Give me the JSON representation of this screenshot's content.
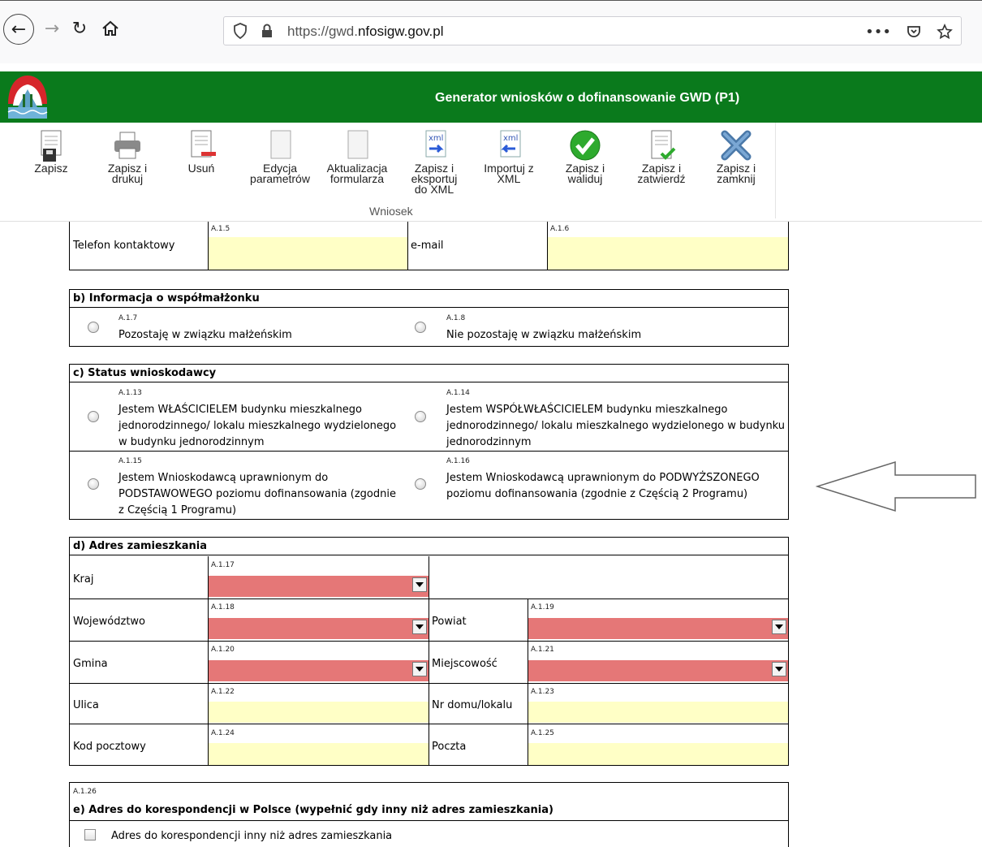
{
  "browser": {
    "url_prefix": "https://gwd.",
    "url_domain": "nfosigw.gov.pl",
    "menu_dots": "•••"
  },
  "app": {
    "title": "Generator wniosków o dofinansowanie GWD (P1)"
  },
  "ribbon": {
    "group_label": "Wniosek",
    "tools": [
      {
        "label1": "Zapisz",
        "label2": "",
        "label3": "",
        "icon": "save-icon"
      },
      {
        "label1": "Zapisz i",
        "label2": "drukuj",
        "label3": "",
        "icon": "print-icon"
      },
      {
        "label1": "Usuń",
        "label2": "",
        "label3": "",
        "icon": "delete-icon"
      },
      {
        "label1": "Edycja",
        "label2": "parametrów",
        "label3": "",
        "icon": "blank-document-icon"
      },
      {
        "label1": "Aktualizacja",
        "label2": "formularza",
        "label3": "",
        "icon": "blank-document-icon"
      },
      {
        "label1": "Zapisz i",
        "label2": "eksportuj",
        "label3": "do XML",
        "icon": "xml-export-icon"
      },
      {
        "label1": "Importuj z",
        "label2": "XML",
        "label3": "",
        "icon": "xml-import-icon"
      },
      {
        "label1": "Zapisz i",
        "label2": "waliduj",
        "label3": "",
        "icon": "check-icon"
      },
      {
        "label1": "Zapisz i",
        "label2": "zatwierdź",
        "label3": "",
        "icon": "approve-document-icon"
      },
      {
        "label1": "Zapisz i",
        "label2": "zamknij",
        "label3": "",
        "icon": "close-x-icon"
      }
    ]
  },
  "contact": {
    "phone_label": "Telefon kontaktowy",
    "phone_code": "A.1.5",
    "email_label": "e-mail",
    "email_code": "A.1.6"
  },
  "spouse": {
    "title": "b) Informacja o współmałżonku",
    "opt1_code": "A.1.7",
    "opt1_label": "Pozostaję w związku małżeńskim",
    "opt2_code": "A.1.8",
    "opt2_label": "Nie pozostaję w związku małżeńskim"
  },
  "status": {
    "title": "c) Status wnioskodawcy",
    "opt1_code": "A.1.13",
    "opt1_line1": "Jestem WŁAŚCICIELEM budynku mieszkalnego",
    "opt1_line2": "jednorodzinnego/ lokalu mieszkalnego wydzielonego",
    "opt1_line3": "w budynku jednorodzinnym",
    "opt2_code": "A.1.14",
    "opt2_line1": "Jestem WSPÓŁWŁAŚCICIELEM budynku mieszkalnego",
    "opt2_line2": "jednorodzinnego/ lokalu mieszkalnego wydzielonego w budynku",
    "opt2_line3": "jednorodzinnym",
    "opt3_code": "A.1.15",
    "opt3_line1": "Jestem Wnioskodawcą uprawnionym do",
    "opt3_line2": "PODSTAWOWEGO poziomu dofinansowania (zgodnie",
    "opt3_line3": "z Częścią 1 Programu)",
    "opt4_code": "A.1.16",
    "opt4_line1": "Jestem Wnioskodawcą uprawnionym do PODWYŻSZONEGO",
    "opt4_line2": "poziomu dofinansowania (zgodnie z Częścią 2 Programu)"
  },
  "address": {
    "title": "d) Adres zamieszkania",
    "kraj": "Kraj",
    "kraj_code": "A.1.17",
    "woj": "Województwo",
    "woj_code": "A.1.18",
    "powiat": "Powiat",
    "powiat_code": "A.1.19",
    "gmina": "Gmina",
    "gmina_code": "A.1.20",
    "miejscowosc": "Miejscowość",
    "miejscowosc_code": "A.1.21",
    "ulica": "Ulica",
    "ulica_code": "A.1.22",
    "nr_domu": "Nr domu/lokalu",
    "nr_domu_code": "A.1.23",
    "kod": "Kod pocztowy",
    "kod_code": "A.1.24",
    "poczta": "Poczta",
    "poczta_code": "A.1.25"
  },
  "correspondence": {
    "code": "A.1.26",
    "title": "e) Adres do korespondencji w Polsce (wypełnić gdy inny niż adres zamieszkania)",
    "checkbox_label": "Adres do korespondencji inny niż adres zamieszkania"
  },
  "colors": {
    "header_green": "#0a7a1c",
    "input_yellow": "#ffffc6",
    "required_red": "#e57777"
  }
}
